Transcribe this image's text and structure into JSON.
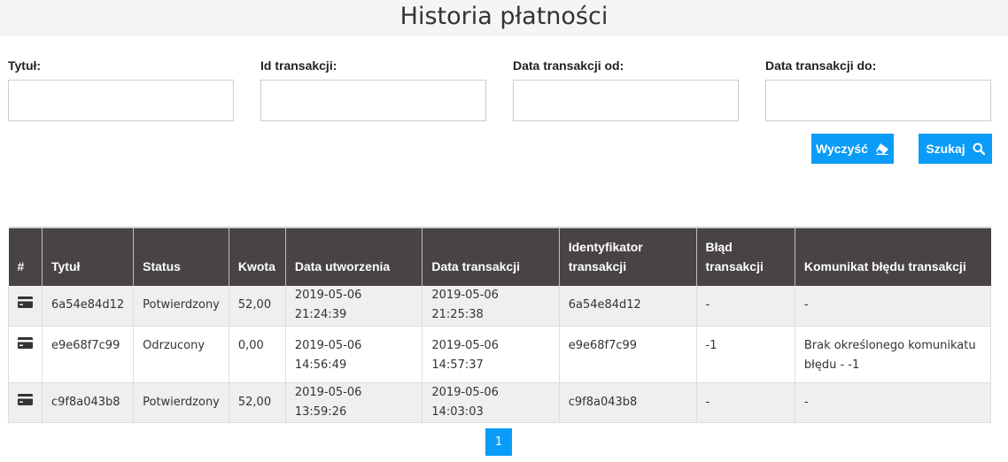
{
  "page": {
    "title": "Historia płatności"
  },
  "filters": {
    "title_label": "Tytuł:",
    "transaction_id_label": "Id transakcji:",
    "date_from_label": "Data transakcji od:",
    "date_to_label": "Data transakcji do:",
    "title_value": "",
    "transaction_id_value": "",
    "date_from_value": "",
    "date_to_value": ""
  },
  "buttons": {
    "clear_label": "Wyczyść",
    "clear_icon": "eraser-icon",
    "search_label": "Szukaj",
    "search_icon": "search-icon",
    "accent_color": "#0a9cf8"
  },
  "table": {
    "headers": {
      "index": "#",
      "title": "Tytuł",
      "status": "Status",
      "amount": "Kwota",
      "created": "Data utworzenia",
      "transaction_date": "Data transakcji",
      "identifier_line1": "Identyfikator",
      "identifier_line2": "transakcji",
      "error_line1": "Błąd",
      "error_line2": "transakcji",
      "error_message": "Komunikat błędu transakcji"
    },
    "rows": [
      {
        "icon": "credit-card-icon",
        "title": "6a54e84d12",
        "status": "Potwierdzony",
        "amount": "52,00",
        "created": "2019-05-06 21:24:39",
        "transaction_date": "2019-05-06 21:25:38",
        "identifier": "6a54e84d12",
        "error": "-",
        "error_message": "-"
      },
      {
        "icon": "credit-card-icon",
        "title": "e9e68f7c99",
        "status": "Odrzucony",
        "amount": "0,00",
        "created": "2019-05-06 14:56:49",
        "transaction_date": "2019-05-06 14:57:37",
        "identifier": "e9e68f7c99",
        "error": "-1",
        "error_message": "Brak określonego komunikatu błędu - -1"
      },
      {
        "icon": "credit-card-icon",
        "title": "c9f8a043b8",
        "status": "Potwierdzony",
        "amount": "52,00",
        "created": "2019-05-06 13:59:26",
        "transaction_date": "2019-05-06 14:03:03",
        "identifier": "c9f8a043b8",
        "error": "-",
        "error_message": "-"
      }
    ]
  },
  "pagination": {
    "current_page": "1"
  }
}
